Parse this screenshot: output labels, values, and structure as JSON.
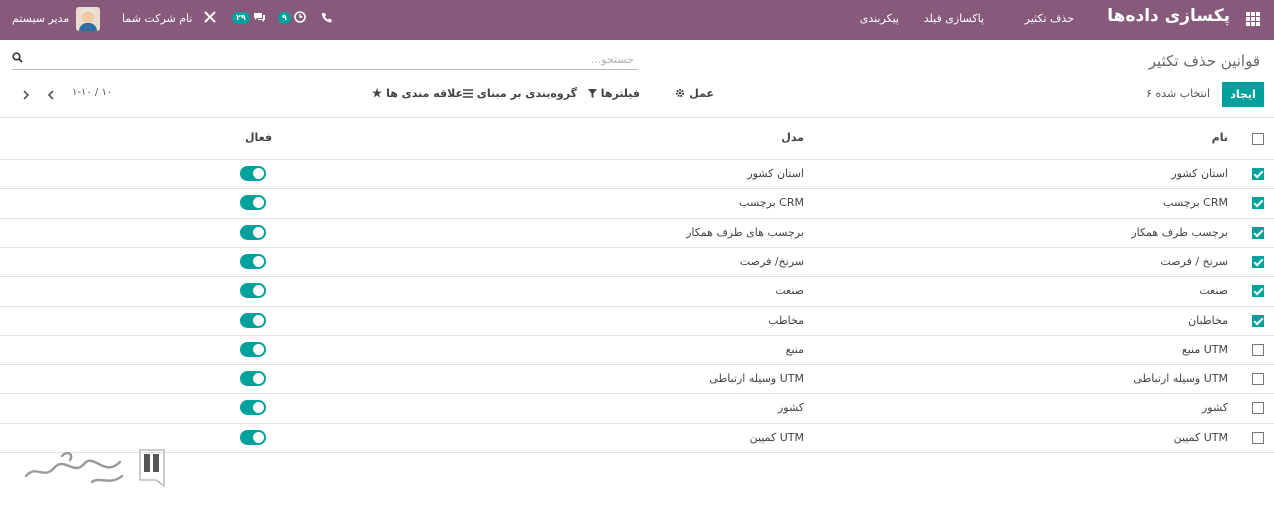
{
  "navbar": {
    "brand": "پکسازی داده‌ها",
    "menu": [
      "حذف تکثیر",
      "پاکسازی فیلد",
      "پیکربندی"
    ],
    "company": "نام شرکت شما",
    "user": "مدیر سیستم",
    "activity_count": "۹",
    "message_count": "۲۹",
    "icons": [
      "apps-grid-icon",
      "phone-icon",
      "clock-icon",
      "chat-icon",
      "tools-icon"
    ]
  },
  "control_panel": {
    "title": "قوانین حذف تکثیر",
    "search_placeholder": "جستجو...",
    "create_label": "ایجاد",
    "selected_text": "۶ انتخاب شده",
    "action_label": "عمل",
    "filters_label": "فیلترها",
    "groupby_label": "گروه‌بندی بر مبنای",
    "favorites_label": "علاقه مندی ها",
    "pager_value": "۱-۱۰ / ۱۰"
  },
  "table": {
    "headers": {
      "name": "نام",
      "model": "مدل",
      "active": "فعال"
    },
    "rows": [
      {
        "name": "استان کشور",
        "model": "استان کشور",
        "checked": true,
        "active": true
      },
      {
        "name": "برچسب CRM",
        "model": "برچسب CRM",
        "checked": true,
        "active": true
      },
      {
        "name": "برچسب طرف همکار",
        "model": "برچسب های طرف همکار",
        "checked": true,
        "active": true
      },
      {
        "name": "سرنخ / فرصت",
        "model": "سرنخ/ فرصت",
        "checked": true,
        "active": true
      },
      {
        "name": "صنعت",
        "model": "صنعت",
        "checked": true,
        "active": true
      },
      {
        "name": "مخاطبان",
        "model": "مخاطب",
        "checked": true,
        "active": true
      },
      {
        "name": "منبع UTM",
        "model": "منبع",
        "checked": false,
        "active": true
      },
      {
        "name": "وسیله ارتباطی UTM",
        "model": "وسیله ارتباطی UTM",
        "checked": false,
        "active": true
      },
      {
        "name": "کشور",
        "model": "کشور",
        "checked": false,
        "active": true
      },
      {
        "name": "کمپین UTM",
        "model": "کمپین UTM",
        "checked": false,
        "active": true
      }
    ]
  },
  "colors": {
    "navbar": "#875a7b",
    "accent": "#00a09d"
  }
}
